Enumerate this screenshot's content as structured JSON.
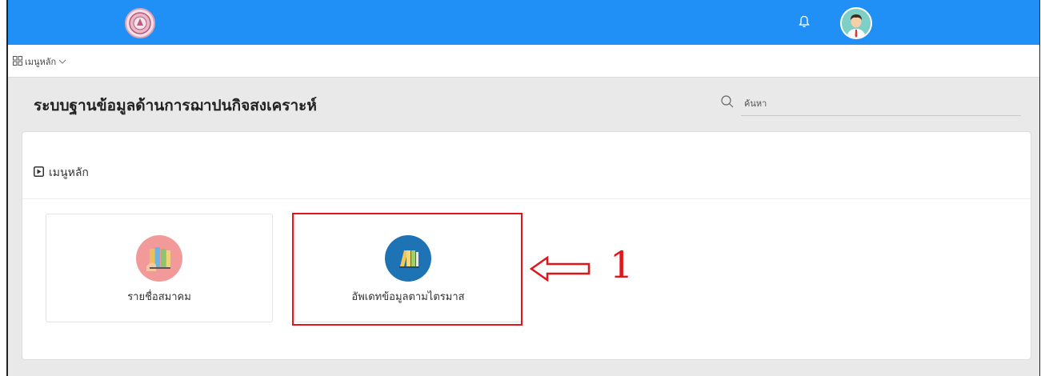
{
  "header": {
    "logo_icon": "royal-seal-icon",
    "notification_icon": "bell-icon",
    "avatar_icon": "user-avatar-icon",
    "accent_color": "#2190f6"
  },
  "menubar": {
    "main_menu_label": "เมนูหลัก",
    "toggle_icon": "grid-icon",
    "chevron_icon": "chevron-down-icon"
  },
  "page": {
    "title": "ระบบฐานข้อมูลด้านการฌาปนกิจสงเคราะห์"
  },
  "search": {
    "placeholder": "ค้นหา",
    "icon": "search-icon"
  },
  "panel": {
    "title": "เมนูหลัก",
    "title_icon": "play-square-icon"
  },
  "cards": [
    {
      "label": "รายชื่อสมาคม",
      "icon": "folders-icon",
      "color": "#f29a9a"
    },
    {
      "label": "อัพเดทข้อมูลตามไตรมาส",
      "icon": "books-icon",
      "color": "#1e73b5"
    }
  ],
  "annotation": {
    "number": "1",
    "color": "#e0161b"
  }
}
